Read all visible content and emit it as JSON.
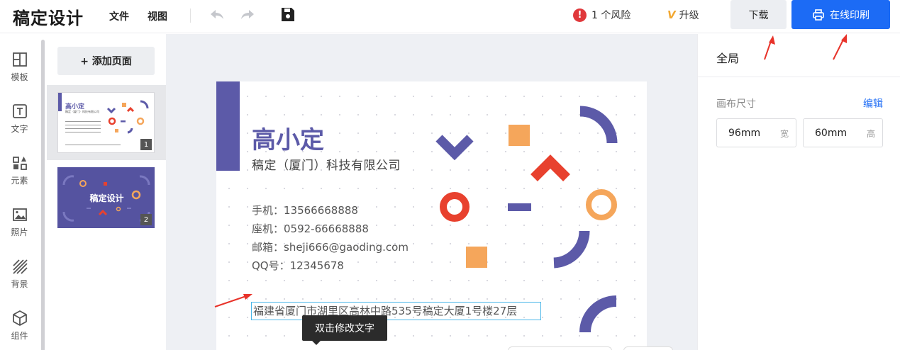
{
  "app": {
    "title": "稿定设计"
  },
  "menu": {
    "file": "文件",
    "view": "视图"
  },
  "toolbar": {
    "risk_count": "!",
    "risk_text": "1 个风险",
    "upgrade_badge": "V",
    "upgrade_text": "升级",
    "download": "下载",
    "print": "在线印刷"
  },
  "sidebar": {
    "items": [
      {
        "label": "模板",
        "icon": "template-icon"
      },
      {
        "label": "文字",
        "icon": "text-icon"
      },
      {
        "label": "元素",
        "icon": "elements-icon"
      },
      {
        "label": "照片",
        "icon": "photo-icon"
      },
      {
        "label": "背景",
        "icon": "background-icon"
      },
      {
        "label": "组件",
        "icon": "component-icon"
      }
    ]
  },
  "pages": {
    "add_label": "+ 添加页面",
    "thumbs": [
      {
        "number": "1",
        "name": "高小定",
        "company": "稿定（厦门）科技有限公司"
      },
      {
        "number": "2",
        "title": "稿定设计"
      }
    ]
  },
  "card": {
    "name": "高小定",
    "company": "稿定（厦门）科技有限公司",
    "phone": "手机：13566668888",
    "landline": "座机：0592-66668888",
    "email": "邮箱：sheji666@gaoding.com",
    "qq": "QQ号：12345678",
    "address": "福建省厦门市湖里区高林中路535号稿定大厦1号楼27层",
    "tooltip": "双击修改文字",
    "colors": {
      "purple": "#5c5aa8",
      "red": "#e8412e",
      "orange": "#f5a65b"
    }
  },
  "panel": {
    "title": "全局",
    "canvas_size_label": "画布尺寸",
    "edit": "编辑",
    "width_value": "96mm",
    "width_unit": "宽",
    "height_value": "60mm",
    "height_unit": "高"
  },
  "colors": {
    "accent": "#1c6bf5",
    "annotation": "#e8332a"
  }
}
